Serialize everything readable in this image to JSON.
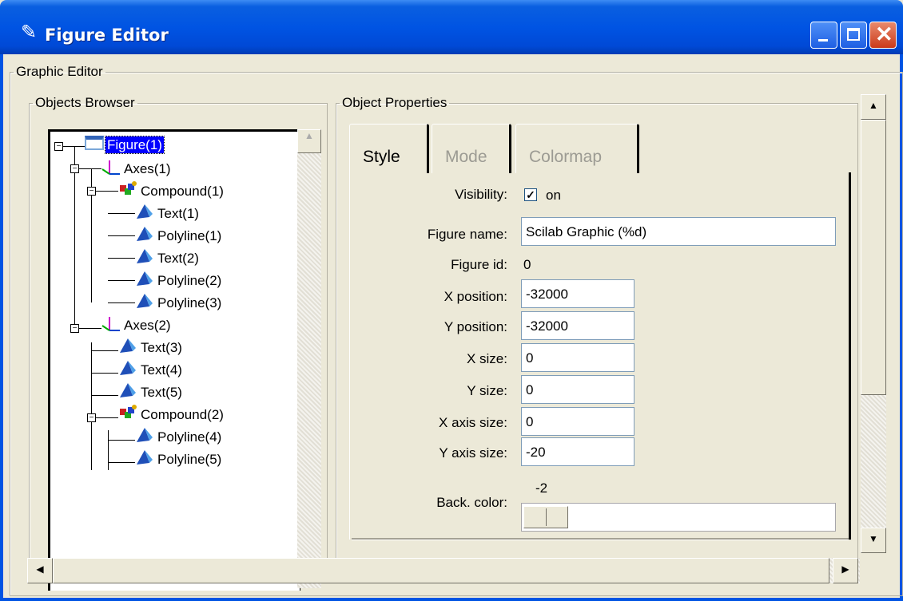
{
  "window": {
    "title": "Figure Editor"
  },
  "graphic_editor": {
    "legend": "Graphic Editor"
  },
  "objects_browser": {
    "legend": "Objects Browser",
    "tree": [
      {
        "label": "Figure(1)",
        "icon": "figure-icon",
        "selected": true
      },
      {
        "label": "Axes(1)",
        "icon": "axes-icon"
      },
      {
        "label": "Compound(1)",
        "icon": "compound-icon"
      },
      {
        "label": "Text(1)",
        "icon": "pyramid-icon"
      },
      {
        "label": "Polyline(1)",
        "icon": "pyramid-icon"
      },
      {
        "label": "Text(2)",
        "icon": "pyramid-icon"
      },
      {
        "label": "Polyline(2)",
        "icon": "pyramid-icon"
      },
      {
        "label": "Polyline(3)",
        "icon": "pyramid-icon"
      },
      {
        "label": "Axes(2)",
        "icon": "axes-icon"
      },
      {
        "label": "Text(3)",
        "icon": "pyramid-icon"
      },
      {
        "label": "Text(4)",
        "icon": "pyramid-icon"
      },
      {
        "label": "Text(5)",
        "icon": "pyramid-icon"
      },
      {
        "label": "Compound(2)",
        "icon": "compound-icon"
      },
      {
        "label": "Polyline(4)",
        "icon": "pyramid-icon"
      },
      {
        "label": "Polyline(5)",
        "icon": "pyramid-icon"
      }
    ]
  },
  "object_properties": {
    "legend": "Object Properties",
    "tabs": [
      {
        "label": "Style",
        "active": true
      },
      {
        "label": "Mode",
        "active": false
      },
      {
        "label": "Colormap",
        "active": false
      }
    ],
    "visibility": {
      "label": "Visibility:",
      "value": "on",
      "checked": true
    },
    "figure_name": {
      "label": "Figure name:",
      "value": "Scilab Graphic (%d)"
    },
    "figure_id": {
      "label": "Figure id:",
      "value": "0"
    },
    "x_position": {
      "label": "X position:",
      "value": "-32000"
    },
    "y_position": {
      "label": "Y position:",
      "value": "-32000"
    },
    "x_size": {
      "label": "X size:",
      "value": "0"
    },
    "y_size": {
      "label": "Y size:",
      "value": "0"
    },
    "x_axis_size": {
      "label": "X axis size:",
      "value": "0"
    },
    "y_axis_size": {
      "label": "Y axis size:",
      "value": "-20"
    },
    "back_color": {
      "label": "Back. color:",
      "value": "-2"
    }
  },
  "colors": {
    "titlebar": "#0054e3",
    "selection": "#0000ff",
    "face": "#ece9d8"
  }
}
